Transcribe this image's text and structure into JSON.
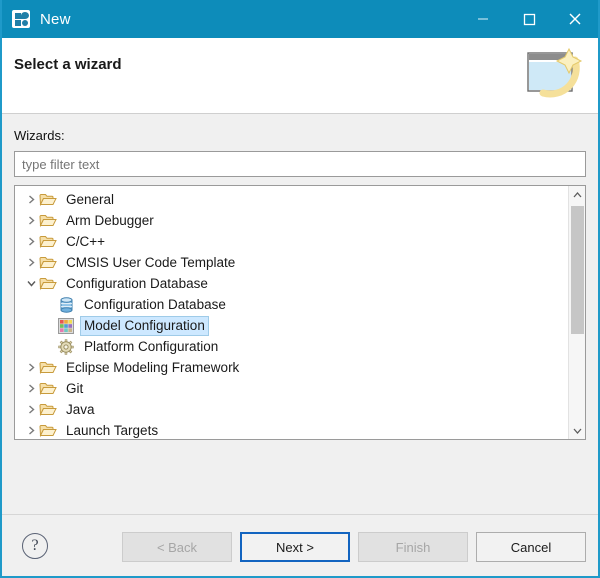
{
  "window": {
    "title": "New",
    "app_icon": "new-wizard-icon",
    "titlebar_color": "#0d8cba",
    "controls": [
      {
        "name": "minimize",
        "glyph": "minimize-icon"
      },
      {
        "name": "maximize",
        "glyph": "maximize-icon"
      },
      {
        "name": "close",
        "glyph": "close-icon"
      }
    ]
  },
  "banner": {
    "title": "Select a wizard",
    "icon": "wizard-banner-icon"
  },
  "form": {
    "wizards_label": "Wizards:",
    "filter_placeholder": "type filter text",
    "filter_value": ""
  },
  "tree": {
    "selection_color": "#cde8ff",
    "items": [
      {
        "label": "General",
        "icon": "folder-icon",
        "level": 0,
        "expanded": false,
        "selected": false
      },
      {
        "label": "Arm Debugger",
        "icon": "folder-icon",
        "level": 0,
        "expanded": false,
        "selected": false
      },
      {
        "label": "C/C++",
        "icon": "folder-icon",
        "level": 0,
        "expanded": false,
        "selected": false
      },
      {
        "label": "CMSIS User Code Template",
        "icon": "folder-icon",
        "level": 0,
        "expanded": false,
        "selected": false
      },
      {
        "label": "Configuration Database",
        "icon": "folder-icon",
        "level": 0,
        "expanded": true,
        "selected": false
      },
      {
        "label": "Configuration Database",
        "icon": "database-icon",
        "level": 1,
        "expanded": null,
        "selected": false
      },
      {
        "label": "Model Configuration",
        "icon": "model-mosaic-icon",
        "level": 1,
        "expanded": null,
        "selected": true
      },
      {
        "label": "Platform Configuration",
        "icon": "gear-icon",
        "level": 1,
        "expanded": null,
        "selected": false
      },
      {
        "label": "Eclipse Modeling Framework",
        "icon": "folder-icon",
        "level": 0,
        "expanded": false,
        "selected": false
      },
      {
        "label": "Git",
        "icon": "folder-icon",
        "level": 0,
        "expanded": false,
        "selected": false
      },
      {
        "label": "Java",
        "icon": "folder-icon",
        "level": 0,
        "expanded": false,
        "selected": false
      },
      {
        "label": "Launch Targets",
        "icon": "folder-icon",
        "level": 0,
        "expanded": false,
        "selected": false
      }
    ]
  },
  "footer": {
    "help_label": "?",
    "buttons": [
      {
        "label": "< Back",
        "state": "disabled"
      },
      {
        "label": "Next >",
        "state": "focused"
      },
      {
        "label": "Finish",
        "state": "disabled"
      },
      {
        "label": "Cancel",
        "state": "enabled"
      }
    ]
  }
}
